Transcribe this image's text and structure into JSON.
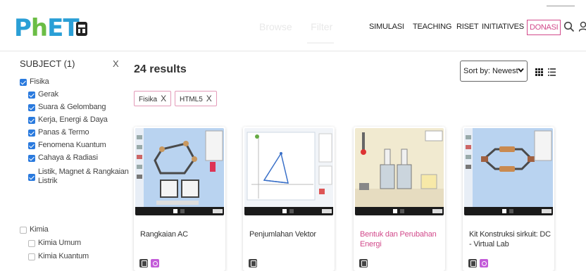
{
  "header": {
    "logo_letters": [
      "P",
      "h",
      "E",
      "T"
    ],
    "ghost_tabs": [
      "Browse",
      "Filter"
    ],
    "nav": [
      "SIMULASI",
      "TEACHING",
      "RISET",
      "INITIATIVES"
    ],
    "donate_label": "DONASI"
  },
  "sidebar": {
    "subject_title": "SUBJECT (1)",
    "clear_label": "X",
    "filters": [
      {
        "label": "Fisika",
        "checked": true,
        "indent": 0
      },
      {
        "label": "Gerak",
        "checked": true,
        "indent": 1
      },
      {
        "label": "Suara & Gelombang",
        "checked": true,
        "indent": 1
      },
      {
        "label": "Kerja, Energi & Daya",
        "checked": true,
        "indent": 1
      },
      {
        "label": "Panas & Termo",
        "checked": true,
        "indent": 1
      },
      {
        "label": "Fenomena Kuantum",
        "checked": true,
        "indent": 1
      },
      {
        "label": "Cahaya & Radiasi",
        "checked": true,
        "indent": 1
      },
      {
        "label": "Listik, Magnet & Rangkaian",
        "label2": "Listrik",
        "checked": true,
        "indent": 1
      },
      {
        "label": "Kimia",
        "checked": false,
        "indent": 0
      },
      {
        "label": "Kimia Umum",
        "checked": false,
        "indent": 1
      },
      {
        "label": "Kimia Kuantum",
        "checked": false,
        "indent": 1
      }
    ]
  },
  "main": {
    "results_count": "24 results",
    "sort_label": "Sort by: Newest",
    "active_filters": [
      "Fisika",
      "HTML5"
    ],
    "chip_remove": "X",
    "cards": [
      {
        "title": "Rangkaian AC",
        "highlight": false,
        "badges": [
          "html5",
          "pink"
        ]
      },
      {
        "title": "Penjumlahan Vektor",
        "highlight": false,
        "badges": [
          "html5"
        ]
      },
      {
        "title": "Bentuk dan Perubahan Energi",
        "highlight": true,
        "badges": [
          "html5"
        ]
      },
      {
        "title": "Kit Konstruksi sirkuit: DC - Virtual Lab",
        "highlight": false,
        "badges": [
          "html5",
          "pink"
        ]
      }
    ]
  },
  "colors": {
    "brand_blue": "#2a9fd6",
    "brand_green": "#6bbd45",
    "brand_orange": "#f4a419",
    "accent_pink": "#d24a8b",
    "checkbox_blue": "#2a7ade"
  }
}
